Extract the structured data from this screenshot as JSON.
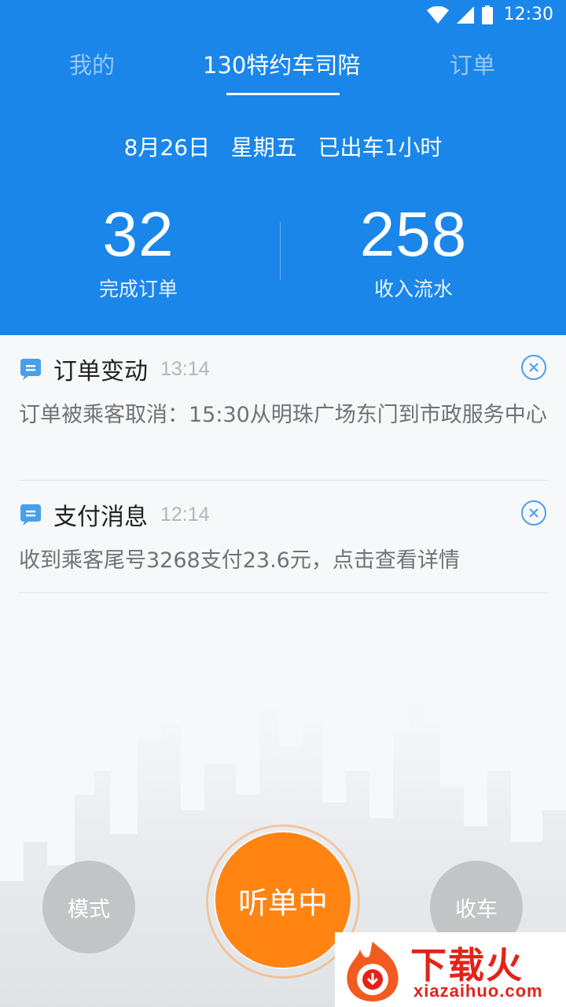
{
  "status_bar": {
    "time": "12:30",
    "icons": [
      "wifi-icon",
      "signal-icon",
      "battery-icon"
    ]
  },
  "tabs": [
    {
      "label": "我的",
      "active": false
    },
    {
      "label": "130特约车司陪",
      "active": true
    },
    {
      "label": "订单",
      "active": false
    }
  ],
  "summary": {
    "date": "8月26日",
    "weekday": "星期五",
    "duration": "已出车1小时",
    "orders_value": "32",
    "orders_label": "完成订单",
    "income_value": "258",
    "income_label": "收入流水"
  },
  "messages": [
    {
      "icon": "message-icon",
      "title": "订单变动",
      "time": "13:14",
      "body": "订单被乘客取消：15:30从明珠广场东门到市政服务中心"
    },
    {
      "icon": "message-icon",
      "title": "支付消息",
      "time": "12:14",
      "body": "收到乘客尾号3268支付23.6元，点击查看详情"
    }
  ],
  "controls": {
    "mode_label": "模式",
    "listening_label": "听单中",
    "stop_label": "收车"
  },
  "watermark": {
    "text": "下载火",
    "url": "xiazaihuo.com"
  },
  "colors": {
    "header_blue": "#1a86ea",
    "accent_orange": "#ff8411",
    "button_gray": "#c3c4c6",
    "watermark_red": "#e2231a"
  }
}
